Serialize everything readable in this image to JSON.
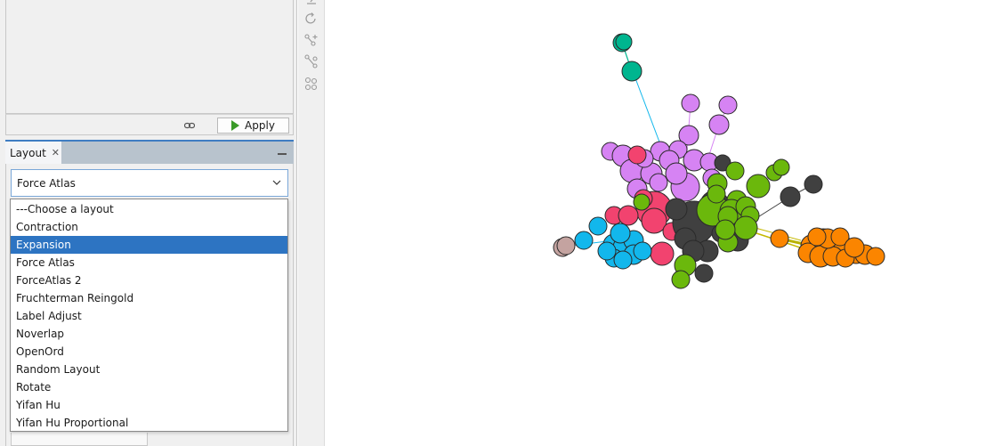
{
  "filters": {
    "apply_label": "Apply"
  },
  "layout_panel": {
    "tab_label": "Layout",
    "tab_close": "✕",
    "selected_layout": "Force Atlas",
    "options": [
      "---Choose a layout",
      "Contraction",
      "Expansion",
      "Force Atlas",
      "ForceAtlas 2",
      "Fruchterman Reingold",
      "Label Adjust",
      "Noverlap",
      "OpenOrd",
      "Random Layout",
      "Rotate",
      "Yifan Hu",
      "Yifan Hu Proportional"
    ],
    "highlighted_option": "Expansion"
  },
  "toolbar": {
    "icons": [
      "node-pencil-icon",
      "rotate-icon",
      "add-edge-icon",
      "edge-select-icon",
      "shortest-path-icon"
    ]
  },
  "graph": {
    "node_colors": {
      "teal": "#00b58f",
      "violet": "#d683f3",
      "pink": "#f2436f",
      "dark": "#404040",
      "green": "#6bb80c",
      "blue": "#12b7ec",
      "orange": "#fb8500",
      "taupe": "#c4a3a0"
    }
  }
}
